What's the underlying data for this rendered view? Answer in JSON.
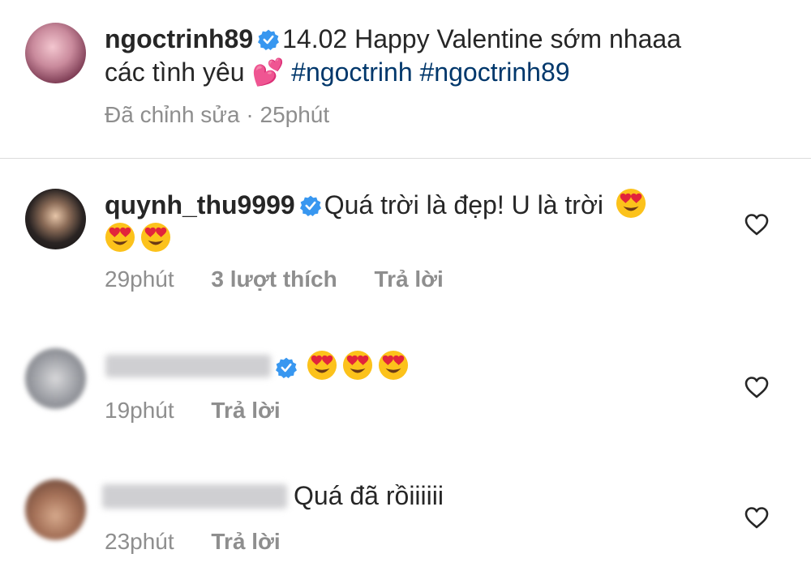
{
  "caption": {
    "username": "ngoctrinh89",
    "text_line1": "14.02 Happy Valentine sớm nhaaa",
    "text_line2": "các tình yêu",
    "emoji": "💕",
    "hashtags": "#ngoctrinh #ngoctrinh89",
    "meta_edited": "Đã chỉnh sửa",
    "meta_sep": " · ",
    "meta_time": "25phút"
  },
  "comments": [
    {
      "username": "quynh_thu9999",
      "text": "Quá trời là đẹp! U là trời",
      "time": "29phút",
      "likes": "3 lượt thích",
      "reply": "Trả lời"
    },
    {
      "username": "",
      "time": "19phút",
      "reply": "Trả lời"
    },
    {
      "username": "",
      "text": "Quá đã rồiiiiii",
      "time": "23phút",
      "reply": "Trả lời"
    }
  ],
  "colors": {
    "verified": "#3897f0",
    "hashtag": "#00376b",
    "meta": "#8e8e8e"
  }
}
